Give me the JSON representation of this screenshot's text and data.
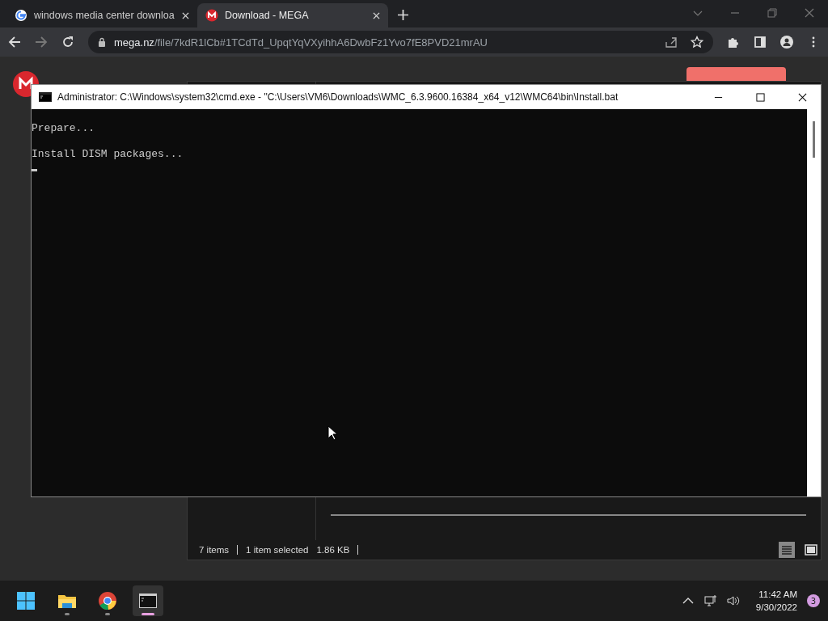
{
  "browser": {
    "tabs": [
      {
        "title": "windows media center downloa",
        "kind": "google",
        "selected": false
      },
      {
        "title": "Download - MEGA",
        "kind": "mega",
        "selected": true
      }
    ],
    "address": {
      "domain": "mega.nz",
      "path": "/file/7kdR1lCb#1TCdTd_UpqtYqVXyihhA6DwbFz1Yvo7fE8PVD21mrAU"
    }
  },
  "explorer": {
    "status": [
      "7 items",
      "1 item selected",
      "1.86 KB"
    ]
  },
  "cmd": {
    "title": "Administrator: C:\\Windows\\system32\\cmd.exe - \"C:\\Users\\VM6\\Downloads\\WMC_6.3.9600.16384_x64_v12\\WMC64\\bin\\Install.bat",
    "lines": [
      "Prepare...",
      "Install DISM packages..."
    ]
  },
  "taskbar": {
    "apps": [
      {
        "kind": "explorer",
        "selected": false
      },
      {
        "kind": "chrome",
        "selected": false
      },
      {
        "kind": "terminal",
        "selected": true
      }
    ],
    "time": "11:42 AM",
    "date": "9/30/2022",
    "notifications": "3"
  }
}
